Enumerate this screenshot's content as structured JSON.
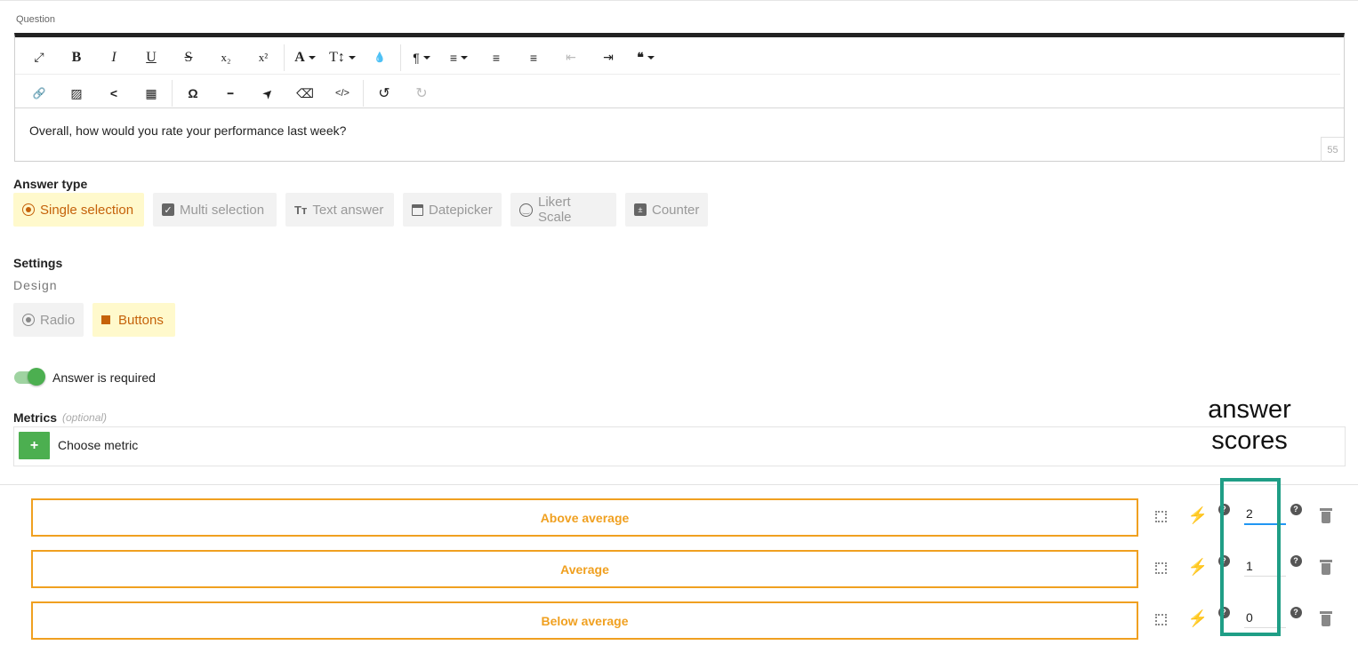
{
  "question": {
    "label": "Question",
    "text": "Overall, how would you rate your performance last week?",
    "char_count": "55"
  },
  "toolbar": {
    "row1": [
      "expand-icon",
      "bold-icon",
      "italic-icon",
      "underline-icon",
      "strikethrough-icon",
      "subscript-icon",
      "superscript-icon",
      "font-color-icon",
      "font-size-icon",
      "ink-drop-icon",
      "paragraph-icon",
      "align-icon",
      "ordered-list-icon",
      "unordered-list-icon",
      "outdent-icon",
      "indent-icon",
      "quote-icon"
    ],
    "row2": [
      "link-icon",
      "image-icon",
      "share-icon",
      "table-icon",
      "omega-icon",
      "horizontal-line-icon",
      "cursor-icon",
      "eraser-icon",
      "code-icon",
      "undo-icon",
      "redo-icon"
    ],
    "glyphs": {
      "bold": "B",
      "italic": "I",
      "underline": "U",
      "strike": "S",
      "sub": "x₂",
      "sup": "x²",
      "font": "A",
      "size": "T↕",
      "drop": "💧",
      "para": "¶",
      "align": "≡",
      "ol": "≡",
      "ul": "≡",
      "outdent": "⇤",
      "indent": "⇥",
      "quote": "❝",
      "link": "🔗",
      "image": "▨",
      "share": "<",
      "table": "▦",
      "omega": "Ω",
      "hr": "━",
      "cursor": "➤",
      "eraser": "⌫",
      "code": "</>",
      "undo": "↺",
      "redo": "↻",
      "expand": "⤢"
    }
  },
  "answer_type": {
    "title": "Answer type",
    "options": [
      {
        "label": "Single selection",
        "icon": "radio-icon",
        "active": true
      },
      {
        "label": "Multi selection",
        "icon": "checkbox-icon",
        "active": false
      },
      {
        "label": "Text answer",
        "icon": "text-icon",
        "active": false
      },
      {
        "label": "Datepicker",
        "icon": "calendar-icon",
        "active": false
      },
      {
        "label": "Likert Scale",
        "icon": "smiley-icon",
        "active": false
      },
      {
        "label": "Counter",
        "icon": "counter-icon",
        "active": false
      }
    ]
  },
  "settings": {
    "title": "Settings",
    "design_label": "Design",
    "design_options": [
      {
        "label": "Radio",
        "active": false
      },
      {
        "label": "Buttons",
        "active": true
      }
    ],
    "required_label": "Answer is required",
    "required": true
  },
  "metrics": {
    "title": "Metrics",
    "optional": "(optional)",
    "choose_label": "Choose metric",
    "plus": "+"
  },
  "answers": [
    {
      "label": "Above average",
      "score": "2"
    },
    {
      "label": "Average",
      "score": "1"
    },
    {
      "label": "Below average",
      "score": "0"
    }
  ],
  "annotation": {
    "line1": "answer",
    "line2": "scores"
  },
  "colors": {
    "accent": "#f0a020",
    "active_text": "#c5620a",
    "active_bg": "#fff9cc",
    "green": "#4caf50",
    "annotation": "#1f9e86"
  }
}
